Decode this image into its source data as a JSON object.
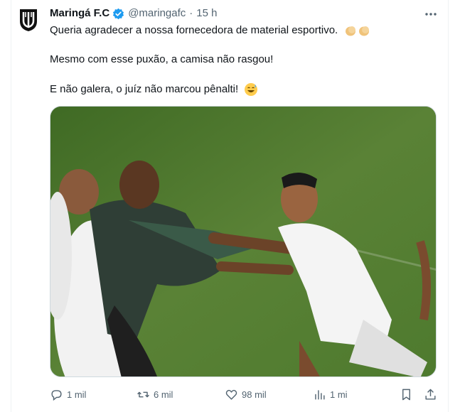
{
  "tweet": {
    "author_name": "Maringá F.C",
    "handle": "@maringafc",
    "separator": "·",
    "time": "15 h",
    "line1": "Queria agradecer a nossa fornecedora de material esportivo.",
    "line2": "Mesmo com esse puxão, a camisa não rasgou!",
    "line3": "E não galera, o juíz não marcou pênalti!",
    "verified_color": "#1d9bf0"
  },
  "avatar": {
    "logo_text": "MARINGÁ F.C"
  },
  "media": {
    "description_icon": "photo"
  },
  "actions": {
    "replies": "1 mil",
    "reposts": "6 mil",
    "likes": "98 mil",
    "views": "1 mi"
  },
  "icons": [
    "verified-badge-icon",
    "more-icon",
    "reply-icon",
    "repost-icon",
    "like-icon",
    "views-icon",
    "bookmark-icon",
    "share-icon"
  ]
}
